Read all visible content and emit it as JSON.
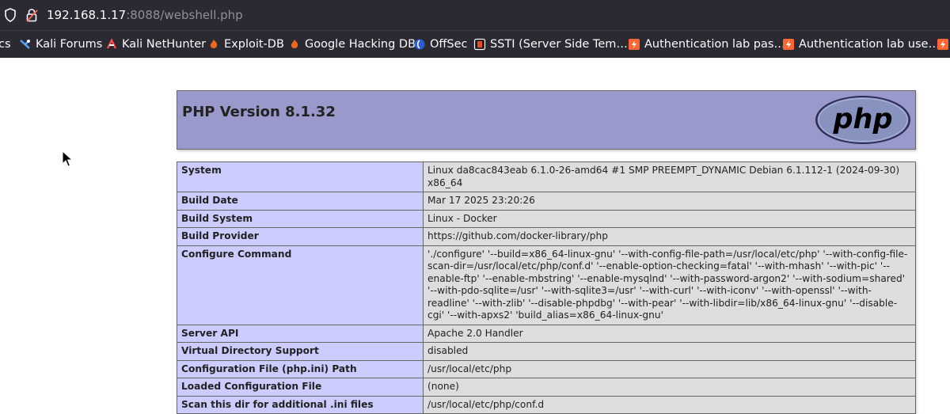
{
  "browser": {
    "url_host": "192.168.1.17",
    "url_rest": ":8088/webshell.php",
    "icons": [
      "shield-icon",
      "insecure-lock-icon"
    ]
  },
  "bookmarks": [
    {
      "label": "cs",
      "icon": "none"
    },
    {
      "label": "Kali Forums",
      "icon": "kali-dragon-icon"
    },
    {
      "label": "Kali NetHunter",
      "icon": "nethunter-icon"
    },
    {
      "label": "Exploit-DB",
      "icon": "exploit-db-icon"
    },
    {
      "label": "Google Hacking DB",
      "icon": "ghdb-icon"
    },
    {
      "label": "OffSec",
      "icon": "offsec-icon"
    },
    {
      "label": "SSTI (Server Side Tem…",
      "icon": "ssti-icon"
    },
    {
      "label": "Authentication lab pas…",
      "icon": "portswigger-icon"
    },
    {
      "label": "Authentication lab use…",
      "icon": "portswigger-icon"
    }
  ],
  "phpinfo": {
    "title": "PHP Version 8.1.32",
    "logo_text": "php",
    "rows": [
      {
        "key": "System",
        "value": "Linux da8cac843eab 6.1.0-26-amd64 #1 SMP PREEMPT_DYNAMIC Debian 6.1.112-1 (2024-09-30) x86_64"
      },
      {
        "key": "Build Date",
        "value": "Mar 17 2025 23:20:26"
      },
      {
        "key": "Build System",
        "value": "Linux - Docker"
      },
      {
        "key": "Build Provider",
        "value": "https://github.com/docker-library/php"
      },
      {
        "key": "Configure Command",
        "value": "'./configure' '--build=x86_64-linux-gnu' '--with-config-file-path=/usr/local/etc/php' '--with-config-file-scan-dir=/usr/local/etc/php/conf.d' '--enable-option-checking=fatal' '--with-mhash' '--with-pic' '--enable-ftp' '--enable-mbstring' '--enable-mysqlnd' '--with-password-argon2' '--with-sodium=shared' '--with-pdo-sqlite=/usr' '--with-sqlite3=/usr' '--with-curl' '--with-iconv' '--with-openssl' '--with-readline' '--with-zlib' '--disable-phpdbg' '--with-pear' '--with-libdir=lib/x86_64-linux-gnu' '--disable-cgi' '--with-apxs2' 'build_alias=x86_64-linux-gnu'"
      },
      {
        "key": "Server API",
        "value": "Apache 2.0 Handler"
      },
      {
        "key": "Virtual Directory Support",
        "value": "disabled"
      },
      {
        "key": "Configuration File (php.ini) Path",
        "value": "/usr/local/etc/php"
      },
      {
        "key": "Loaded Configuration File",
        "value": "(none)"
      },
      {
        "key": "Scan this dir for additional .ini files",
        "value": "/usr/local/etc/php/conf.d"
      }
    ]
  },
  "colors": {
    "chrome_bg": "#2b2a33",
    "header_bg": "#9999cc",
    "key_bg": "#ccccff",
    "value_bg": "#dddddd"
  }
}
